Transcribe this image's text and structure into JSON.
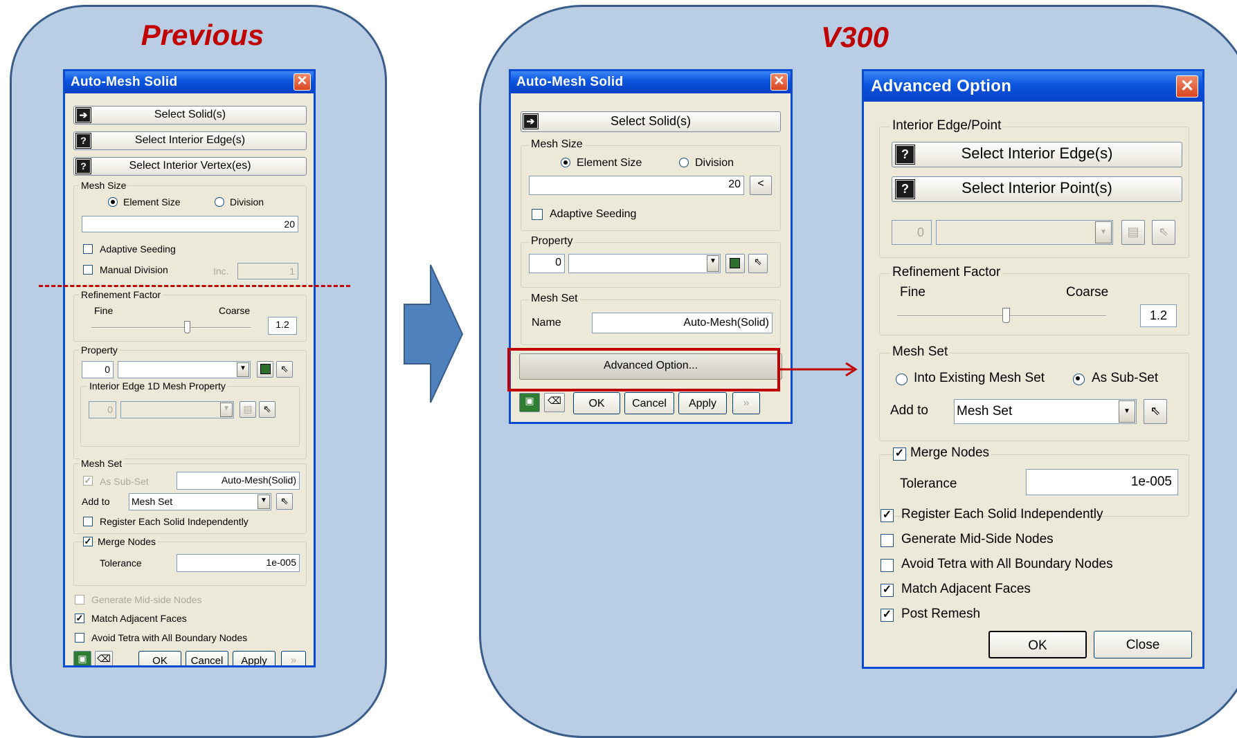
{
  "headings": {
    "previous": "Previous",
    "v300": "V300"
  },
  "prev_dialog": {
    "title": "Auto-Mesh Solid",
    "select_solids": "Select Solid(s)",
    "select_interior_edges": "Select Interior Edge(s)",
    "select_interior_vertexes": "Select Interior Vertex(es)",
    "mesh_size": {
      "legend": "Mesh Size",
      "opt_element": "Element Size",
      "opt_division": "Division",
      "value": "20",
      "selected": "Element Size"
    },
    "adaptive_seeding": "Adaptive Seeding",
    "manual_division": "Manual Division",
    "inc_label": "Inc.",
    "inc_value": "1",
    "refinement": {
      "legend": "Refinement Factor",
      "fine": "Fine",
      "coarse": "Coarse",
      "value": "1.2",
      "level": 0.6
    },
    "property": {
      "legend": "Property",
      "id": "0",
      "sub_legend": "Interior Edge 1D Mesh  Property",
      "sub_id": "0"
    },
    "mesh_set": {
      "legend": "Mesh Set",
      "as_subset": "As Sub-Set",
      "name": "Auto-Mesh(Solid)",
      "add_to": "Add to",
      "add_to_value": "Mesh Set",
      "register": "Register Each Solid Independently"
    },
    "merge_nodes": "Merge Nodes",
    "tolerance_label": "Tolerance",
    "tolerance": "1e-005",
    "gen_midside": "Generate Mid-side Nodes",
    "match_faces": "Match Adjacent Faces",
    "avoid_tetra": "Avoid Tetra with All Boundary Nodes",
    "ok": "OK",
    "cancel": "Cancel",
    "apply": "Apply",
    "more": "»"
  },
  "v300_dialog": {
    "title": "Auto-Mesh Solid",
    "select_solids": "Select Solid(s)",
    "mesh_size": {
      "legend": "Mesh Size",
      "opt_element": "Element Size",
      "opt_division": "Division",
      "value": "20",
      "lt": "<"
    },
    "adaptive_seeding": "Adaptive Seeding",
    "property": {
      "legend": "Property",
      "id": "0"
    },
    "mesh_set": {
      "legend": "Mesh Set",
      "name_label": "Name",
      "name": "Auto-Mesh(Solid)"
    },
    "advanced": "Advanced Option...",
    "ok": "OK",
    "cancel": "Cancel",
    "apply": "Apply",
    "more": "»"
  },
  "advanced_dialog": {
    "title": "Advanced Option",
    "interior": {
      "legend": "Interior Edge/Point",
      "select_edges": "Select Interior Edge(s)",
      "select_points": "Select Interior Point(s)",
      "id": "0"
    },
    "refinement": {
      "legend": "Refinement Factor",
      "fine": "Fine",
      "coarse": "Coarse",
      "value": "1.2",
      "level": 0.52
    },
    "mesh_set": {
      "legend": "Mesh Set",
      "opt_existing": "Into Existing Mesh Set",
      "opt_subset": "As Sub-Set",
      "add_to": "Add to",
      "add_to_value": "Mesh Set"
    },
    "merge_nodes": "Merge Nodes",
    "tolerance_label": "Tolerance",
    "tolerance": "1e-005",
    "register": "Register Each Solid Independently",
    "gen_midside": "Generate Mid-Side Nodes",
    "avoid_tetra": "Avoid Tetra with All Boundary Nodes",
    "match_faces": "Match Adjacent Faces",
    "post_remesh": "Post Remesh",
    "ok": "OK",
    "close": "Close"
  },
  "colors": {
    "panel": "#b9cde5",
    "heading": "#c00000",
    "highlight": "#c00000",
    "arrow": "#4f81bd"
  }
}
